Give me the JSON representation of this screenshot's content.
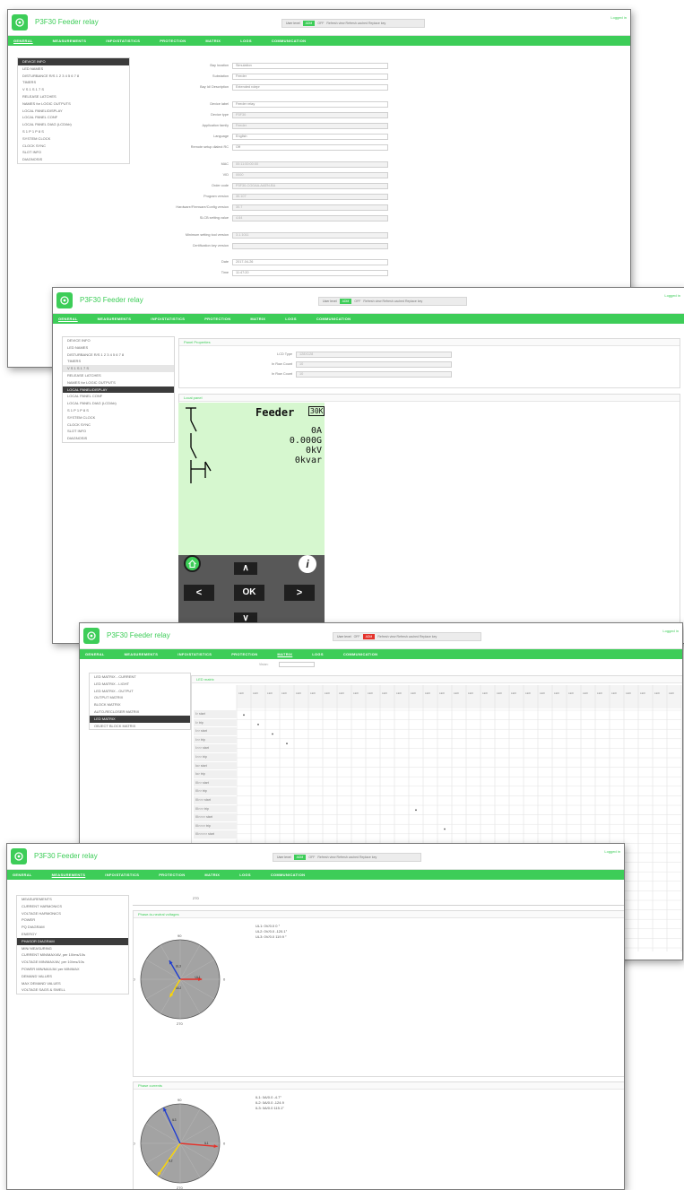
{
  "app": {
    "title": "P3F30 Feeder relay",
    "logged_in_label": "Logged in"
  },
  "user_level": {
    "label": "User level",
    "level_value": "ADM",
    "level_value_red": "ADM",
    "extra": "OFF",
    "actions": "Refresh view   Refresh cached   Replace key"
  },
  "nav": {
    "tabs": [
      "GENERAL",
      "MEASUREMENTS",
      "INFO/STATISTICS",
      "PROTECTION",
      "MATRIX",
      "LOGS",
      "COMMUNICATION"
    ]
  },
  "general": {
    "sidebar": [
      "DEVICE INFO",
      "LED NAMES",
      "DISTURBANCE R/S 1 2 3 4 5 6 7 8",
      "TIMERS",
      "V S 1 S 1 7 S",
      "RELEASE LATCHES",
      "NAMES for LOGIC OUTPUTS",
      "LOCAL PANEL/DISPLAY",
      "LOCAL PANEL CONF",
      "LOCAL PANEL DIAG (LCD/kb)",
      "S 1 P 1 P 8 S",
      "SYSTEM CLOCK",
      "CLOCK SYNC",
      "SLOT INFO",
      "DIAGNOSIS"
    ],
    "fields": [
      {
        "label": "Bay location",
        "value": "Simulation",
        "gray": false
      },
      {
        "label": "Substation",
        "value": "Feeder",
        "gray": false
      },
      {
        "label": "Bay Id/ Description",
        "value": "Extended rolepr",
        "gray": false
      },
      {
        "label": "Device label",
        "value": "Feeder relay",
        "gray": false
      },
      {
        "label": "Device type",
        "value": "P3F30",
        "gray": true
      },
      {
        "label": "Application family",
        "value": "Feeder",
        "gray": true
      },
      {
        "label": "Language",
        "value": "English",
        "gray": false
      },
      {
        "label": "Remote setup dialect RC",
        "value": "Off",
        "gray": false
      },
      {
        "label": "MAC",
        "value": "00:11:00:00:00",
        "gray": true
      },
      {
        "label": "VID",
        "value": "0000",
        "gray": true
      },
      {
        "label": "Order code",
        "value": "P3F30-CGGAA-AAEN-BA",
        "gray": true
      },
      {
        "label": "Program version",
        "value": "30.107",
        "gray": true
      },
      {
        "label": "Hardware/Firmware/Config version",
        "value": "30.7",
        "gray": true
      },
      {
        "label": "SLCB setting value",
        "value": "4.64",
        "gray": true
      },
      {
        "label": "Minimum setting tool version",
        "value": "3.1.1011",
        "gray": true
      },
      {
        "label": "Certification key version",
        "value": "",
        "gray": true
      },
      {
        "label": "Date",
        "value": "2017-04-26",
        "gray": false
      },
      {
        "label": "Time",
        "value": "11:47:20",
        "gray": false
      }
    ]
  },
  "panel": {
    "sidebar": [
      "DEVICE INFO",
      "LED NAMES",
      "DISTURBANCE R/S 1 2 3 4 5 6 7 8",
      "TIMERS",
      "V S 1 S 1 7 S",
      "RELEASE LATCHES",
      "NAMES for LOGIC OUTPUTS",
      "LOCAL PANEL/DISPLAY",
      "LOCAL PANEL CONF",
      "LOCAL PANEL DIAG (LCD/kb)",
      "S 1 P 1 P 8 S",
      "SYSTEM CLOCK",
      "CLOCK SYNC",
      "SLOT INFO",
      "DIAGNOSIS"
    ],
    "panel_props_title": "Panel Properties",
    "props": [
      {
        "label": "LCD Type",
        "value": "128X128"
      },
      {
        "label": "In Row Count",
        "value": "10"
      },
      {
        "label": "In Row Count",
        "value": "10"
      }
    ],
    "local_panel_title": "Local panel",
    "lcd": {
      "title": "Feeder",
      "badge": "30K",
      "values": [
        "0A",
        "0.000G",
        "0kV",
        "0kvar"
      ]
    },
    "keys": {
      "up": "∧",
      "left": "<",
      "ok": "OK",
      "right": ">",
      "down": "∨",
      "info": "i"
    }
  },
  "matrix": {
    "sidebar": [
      "LED MATRIX - CURRENT",
      "LED MATRIX - LIGHT",
      "LED MATRIX - OUTPUT",
      "OUTPUT MATRIX",
      "BLOCK MATRIX",
      "AUTO-RECLOSER MATRIX",
      "LED MATRIX",
      "OBJECT BLOCK MATRIX"
    ],
    "view_label": "Vision:",
    "section_title": "LED matrix",
    "col_header": "LED",
    "rows": [
      "I> start",
      "I> trip",
      "I>> start",
      "I>> trip",
      "I>>> start",
      "I>>> trip",
      "Io> start",
      "Io> trip",
      "I0>> start",
      "I0>> trip",
      "I0>>> start",
      "I0>>> trip",
      "I0>>>> start",
      "I0>>>> trip",
      "I0>>>>> start"
    ]
  },
  "measurements": {
    "sidebar": [
      "MEASUREMENTS",
      "CURRENT HARMONICS",
      "VOLTAGE HARMONICS",
      "POWER",
      "PQ DIAGRAM",
      "ENERGY",
      "PHASOR DIAGRAM",
      "MIN/ MEASURING",
      "CURRENT MIN/MAX/AV, per 10/ms/10s",
      "VOLTAGE MIN/MAX/AV, per 10/ms/10s",
      "POWER MIN/MAX/AV per MIN/MAX",
      "DEMAND VALUES",
      "MAX DEMAND VALUES",
      "VOLTAGE SAGS & SWELL"
    ],
    "top_axis_label": "270",
    "voltage_title": "Phase-to-neutral voltages",
    "voltage_readout": [
      "UL1: 0V/0.0 0 °",
      "UL2: 0V/0.0 -120.1°",
      "UL3: 0V/0.0 119.9 °"
    ],
    "current_title": "Phase currents",
    "current_readout": [
      "IL1: 0A/0.0 -4.7°",
      "IL2: 0A/0.0 -124.9",
      "IL3: 0A/0.0 115.1°"
    ],
    "axis": {
      "top": "90",
      "left": "180",
      "right": "0",
      "bottom": "270"
    },
    "vec_labels_v": {
      "l1": "UL1",
      "l2": "UL2",
      "l3": "UL3"
    },
    "vec_labels_i": {
      "l1": "IL1",
      "l2": "IL2",
      "l3": "IL3"
    },
    "colors": {
      "phase1": "#e4322b",
      "phase2": "#ffd800",
      "phase3": "#1e3cd0",
      "accent": "#3dcd58"
    }
  }
}
